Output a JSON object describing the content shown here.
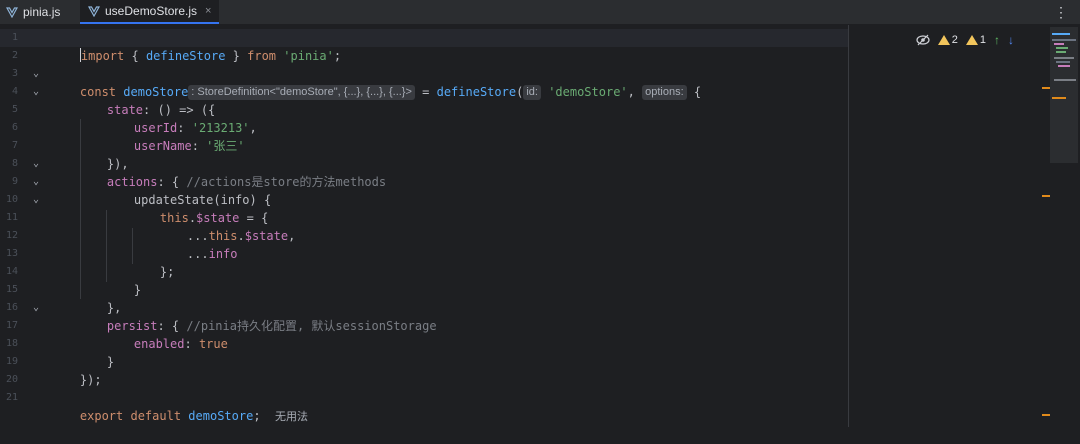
{
  "tabs": [
    {
      "label": "pinia.js",
      "active": false
    },
    {
      "label": "useDemoStore.js",
      "active": true
    }
  ],
  "close_glyph": "×",
  "menu_glyph": "⋮",
  "inspection": {
    "warnings_a": "2",
    "warnings_b": "1",
    "up_arrow": "↑",
    "down_arrow": "↓",
    "eye_icon": "eye-crossed-icon"
  },
  "line_numbers": [
    "1",
    "2",
    "3",
    "4",
    "5",
    "6",
    "7",
    "8",
    "9",
    "10",
    "11",
    "12",
    "13",
    "14",
    "15",
    "16",
    "17",
    "18",
    "19",
    "20",
    "21"
  ],
  "code": {
    "l1": {
      "kw1": "import",
      "p1": " { ",
      "fn1": "defineStore",
      "p2": " } ",
      "kw2": "from",
      "sp": " ",
      "str1": "'pinia'",
      "p3": ";"
    },
    "l3": {
      "kw1": "const",
      "sp1": " ",
      "fn1": "demoStore",
      "hint_type": ": StoreDefinition<\"demoStore\", {...}, {...}, {...}>",
      "p1": " = ",
      "fn2": "defineStore",
      "p2": "(",
      "hint_id": "id:",
      "str1": "'demoStore'",
      "p3": ", ",
      "hint_opts": "options:",
      "p4": "{"
    },
    "l4": {
      "prop": "state",
      "rest": ": () => ({"
    },
    "l5": {
      "prop": "userId",
      "p1": ": ",
      "str": "'213213'",
      "p2": ","
    },
    "l6": {
      "prop": "userName",
      "p1": ": ",
      "str": "'张三'"
    },
    "l7": {
      "rest": "}),"
    },
    "l8": {
      "prop": "actions",
      "p1": ": { ",
      "cmt": "//actions是store的方法methods"
    },
    "l9": {
      "rest": "updateState(info) {"
    },
    "l10": {
      "kw": "this",
      "p1": ".",
      "prop": "$state",
      "rest": " = {"
    },
    "l11": {
      "p1": "...",
      "kw": "this",
      "p2": ".",
      "prop": "$state",
      "p3": ","
    },
    "l12": {
      "p1": "...",
      "ident": "info"
    },
    "l13": {
      "rest": "};"
    },
    "l14": {
      "rest": "}"
    },
    "l15": {
      "rest": "},"
    },
    "l16": {
      "prop": "persist",
      "p1": ": { ",
      "cmt": "//pinia持久化配置, 默认sessionStorage"
    },
    "l17": {
      "prop": "enabled",
      "p1": ": ",
      "kw": "true"
    },
    "l18": {
      "rest": "}"
    },
    "l19": {
      "rest": "});"
    },
    "l21": {
      "kw": "export default",
      "sp": " ",
      "fn": "demoStore",
      "p1": ";",
      "hint": "无用法"
    }
  },
  "colors": {
    "keyword": "#cf8e6d",
    "function": "#57aaf7",
    "property": "#c77dbb",
    "string": "#6aab73",
    "comment": "#7a7e85",
    "warning": "#f2c55c",
    "marker": "#e08a1b"
  }
}
